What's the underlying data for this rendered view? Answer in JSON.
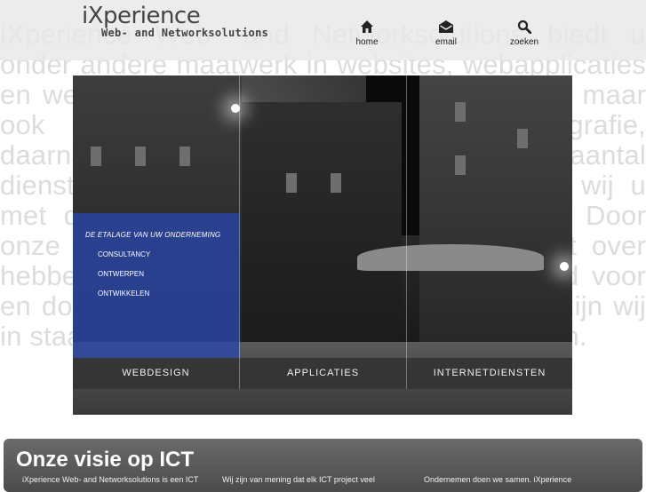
{
  "background_text": "iXperience Web- and Networksolutions biedt u onder andere maatwerk in websites, webapplicaties en webdesign. HTML, CSS, PHP en MySQL maar ook netwerk, videoproductie en fotografie, daarnaast ondersteuning bij een groot aantal diensten. Ook voor websites ondersteunen wij u met de nieuwste en bewezen technologie. Door onze brede ervaring weten wij waar wij het over hebben als het gaat om netwerk opgebouwd voor en door onze klanten en partners. Hierdoor zijn wij in staat om u te adviseren op diverse gebieden.",
  "logo": {
    "top": "iXperience",
    "sub": "Web- and Networksolutions"
  },
  "nav": [
    {
      "label": "home",
      "icon": "home-icon"
    },
    {
      "label": "email",
      "icon": "email-icon"
    },
    {
      "label": "zoeken",
      "icon": "search-icon"
    }
  ],
  "hero": {
    "overlay_title": "DE ETALAGE VAN UW ONDERNEMING",
    "overlay_links": [
      "CONSULTANCY",
      "ONTWERPEN",
      "ONTWIKKELEN"
    ],
    "tabs": [
      "WEBDESIGN",
      "APPLICATIES",
      "INTERNETDIENSTEN"
    ]
  },
  "panel": {
    "title": "Onze visie op ICT",
    "columns": [
      "iXperience Web- and Networksolutions is een ICT",
      "Wij zijn van mening dat elk ICT project veel",
      "Ondernemen doen we samen. iXperience"
    ]
  },
  "colors": {
    "overlay": "#2846aa",
    "tab_bar": "#323232",
    "panel": "#5a5a5a"
  }
}
